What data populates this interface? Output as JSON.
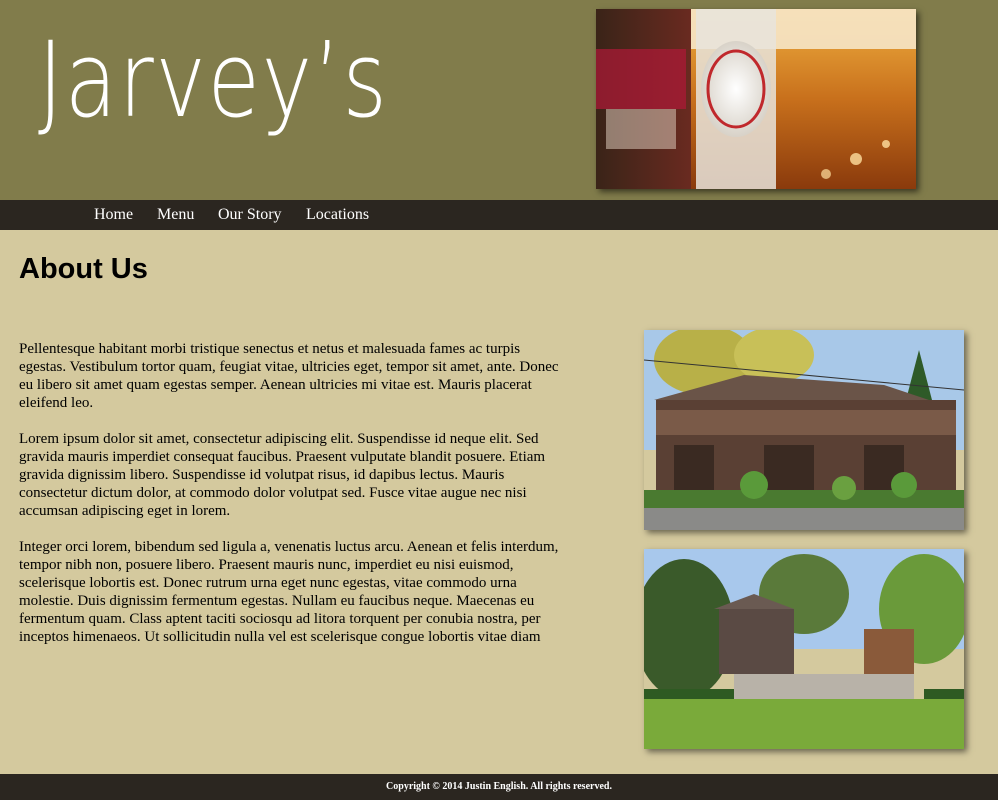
{
  "header": {
    "logo_text": "Jarvey’s"
  },
  "nav": {
    "items": [
      {
        "label": "Home"
      },
      {
        "label": "Menu"
      },
      {
        "label": "Our Story"
      },
      {
        "label": "Locations"
      }
    ]
  },
  "main": {
    "title": "About Us",
    "paragraphs": [
      "Pellentesque habitant morbi tristique senectus et netus et malesuada fames ac turpis egestas. Vestibulum tortor quam, feugiat vitae, ultricies eget, tempor sit amet, ante. Donec eu libero sit amet quam egestas semper. Aenean ultricies mi vitae est. Mauris placerat eleifend leo.",
      "Lorem ipsum dolor sit amet, consectetur adipiscing elit. Suspendisse id neque elit. Sed gravida mauris imperdiet consequat faucibus. Praesent vulputate blandit posuere. Etiam gravida dignissim libero. Suspendisse id volutpat risus, id dapibus lectus. Mauris consectetur dictum dolor, at commodo dolor volutpat sed. Fusce vitae augue nec nisi accumsan adipiscing eget in lorem.",
      "Integer orci lorem, bibendum sed ligula a, venenatis luctus arcu. Aenean et felis interdum, tempor nibh non, posuere libero. Praesent mauris nunc, imperdiet eu nisi euismod, scelerisque lobortis est. Donec rutrum urna eget nunc egestas, vitae commodo urna molestie. Duis dignissim fermentum egestas. Nullam eu faucibus neque. Maecenas eu fermentum quam. Class aptent taciti sociosqu ad litora torquent per conubia nostra, per inceptos himenaeos. Ut sollicitudin nulla vel est scelerisque congue lobortis vitae diam"
    ]
  },
  "footer": {
    "copyright": "Copyright © 2014 Justin English. All rights reserved."
  },
  "colors": {
    "header_bg": "#817c4b",
    "nav_bg": "#2b2620",
    "page_bg": "#d4c99e",
    "footer_bg": "#2b2620"
  }
}
